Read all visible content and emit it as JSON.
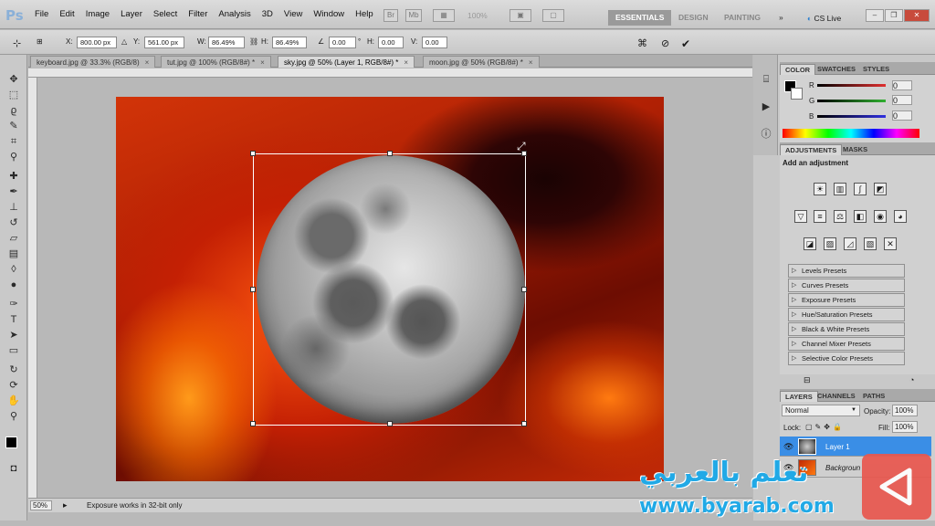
{
  "app": {
    "logo": "Ps"
  },
  "menu": [
    "File",
    "Edit",
    "Image",
    "Layer",
    "Select",
    "Filter",
    "Analysis",
    "3D",
    "View",
    "Window",
    "Help"
  ],
  "appbar": {
    "zoom": "100%",
    "workspaces": [
      "ESSENTIALS",
      "DESIGN",
      "PAINTING"
    ],
    "more": "»",
    "cslive": "CS Live"
  },
  "options": {
    "x_label": "X:",
    "x": "800.00 px",
    "y_label": "Y:",
    "y": "561.00 px",
    "w_label": "W:",
    "w": "86.49%",
    "h_label": "H:",
    "h": "86.49%",
    "angle": "0.00",
    "hskew_label": "H:",
    "hskew": "0.00",
    "vskew_label": "V:",
    "vskew": "0.00"
  },
  "tabs": [
    {
      "label": "keyboard.jpg @ 33.3% (RGB/8)",
      "close": "×"
    },
    {
      "label": "tut.jpg @ 100% (RGB/8#) *",
      "close": "×"
    },
    {
      "label": "sky.jpg @ 50% (Layer 1, RGB/8#) *",
      "close": "×"
    },
    {
      "label": "moon.jpg @ 50% (RGB/8#) *",
      "close": "×"
    }
  ],
  "status": {
    "zoom": "50%",
    "message": "Exposure works in 32-bit only"
  },
  "color_panel": {
    "tabs": [
      "COLOR",
      "SWATCHES",
      "STYLES"
    ],
    "channels": [
      {
        "label": "R",
        "value": "0",
        "color": "#e03030"
      },
      {
        "label": "G",
        "value": "0",
        "color": "#30b030"
      },
      {
        "label": "B",
        "value": "0",
        "color": "#3030e0"
      }
    ]
  },
  "adjustments_panel": {
    "tabs": [
      "ADJUSTMENTS",
      "MASKS"
    ],
    "heading": "Add an adjustment",
    "presets": [
      "Levels Presets",
      "Curves Presets",
      "Exposure Presets",
      "Hue/Saturation Presets",
      "Black & White Presets",
      "Channel Mixer Presets",
      "Selective Color Presets"
    ]
  },
  "layers_panel": {
    "tabs": [
      "LAYERS",
      "CHANNELS",
      "PATHS"
    ],
    "blend_mode": "Normal",
    "opacity_label": "Opacity:",
    "opacity": "100%",
    "lock_label": "Lock:",
    "fill_label": "Fill:",
    "fill": "100%",
    "layers": [
      {
        "name": "Layer 1",
        "selected": true
      },
      {
        "name": "Backgroun",
        "selected": false
      }
    ]
  },
  "watermark": {
    "arabic": "تعلم بالعربي",
    "url": "www.byarab.com"
  },
  "colors": {
    "accent": "#21a9e6",
    "selection": "#3a8ee6"
  }
}
